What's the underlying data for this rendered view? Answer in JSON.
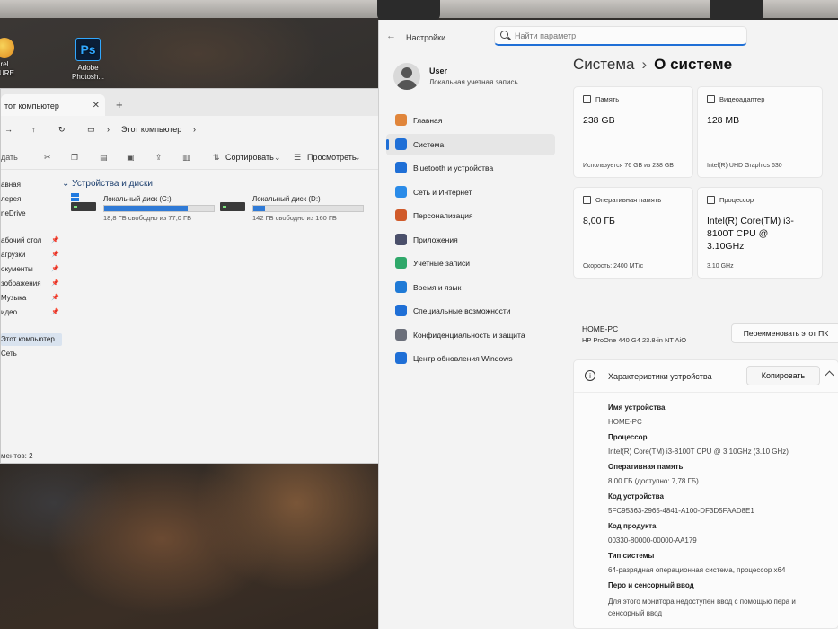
{
  "desktop": {
    "icons": [
      {
        "label": "rel\nTURE"
      },
      {
        "label": "Adobe\nPhotosh..."
      }
    ],
    "ps_glyph": "Ps"
  },
  "explorer": {
    "tab_title": "тот компьютер",
    "address": "Этот компьютер",
    "toolbar": {
      "create": "дать",
      "sort": "Сортировать",
      "view": "Просмотреть"
    },
    "group_title": "Устройства и диски",
    "nav": [
      {
        "label": "авная",
        "pinned": false
      },
      {
        "label": "лерея",
        "pinned": false
      },
      {
        "label": "neDrive",
        "pinned": false
      },
      {
        "label": "абочий стол",
        "pinned": true
      },
      {
        "label": "агрузки",
        "pinned": true
      },
      {
        "label": "окументы",
        "pinned": true
      },
      {
        "label": "зображения",
        "pinned": true
      },
      {
        "label": "Музыка",
        "pinned": true
      },
      {
        "label": "идео",
        "pinned": true
      },
      {
        "label": "Этот компьютер",
        "pinned": false,
        "selected": true
      },
      {
        "label": "Сеть",
        "pinned": false
      }
    ],
    "drives": [
      {
        "name": "Локальный диск (C:)",
        "free": "18,8 ГБ свободно из 77,0 ГБ",
        "used_fraction": 0.76
      },
      {
        "name": "Локальный диск (D:)",
        "free": "142 ГБ свободно из 160 ГБ",
        "used_fraction": 0.11
      }
    ],
    "status": "ментов: 2"
  },
  "settings": {
    "app_title": "Настройки",
    "search_placeholder": "Найти параметр",
    "user": {
      "name": "User",
      "subtitle": "Локальная учетная запись"
    },
    "nav": [
      {
        "label": "Главная",
        "icon": "home-icon",
        "color": "#e0853a"
      },
      {
        "label": "Система",
        "icon": "system-icon",
        "color": "#1f6fd6",
        "selected": true
      },
      {
        "label": "Bluetooth и устройства",
        "icon": "bluetooth-icon",
        "color": "#1f6fd6"
      },
      {
        "label": "Сеть и Интернет",
        "icon": "network-icon",
        "color": "#2a8be8"
      },
      {
        "label": "Персонализация",
        "icon": "brush-icon",
        "color": "#d05a2a"
      },
      {
        "label": "Приложения",
        "icon": "apps-icon",
        "color": "#4a4f6a"
      },
      {
        "label": "Учетные записи",
        "icon": "accounts-icon",
        "color": "#2fa86a"
      },
      {
        "label": "Время и язык",
        "icon": "time-language-icon",
        "color": "#1f7ad6"
      },
      {
        "label": "Специальные возможности",
        "icon": "accessibility-icon",
        "color": "#1f6fd6"
      },
      {
        "label": "Конфиденциальность и защита",
        "icon": "shield-icon",
        "color": "#6b6f7a"
      },
      {
        "label": "Центр обновления Windows",
        "icon": "update-icon",
        "color": "#1f6fd6"
      }
    ],
    "breadcrumb": {
      "parent": "Система",
      "separator": "›",
      "current": "О системе"
    },
    "cards": [
      {
        "title": "Память",
        "value": "238 GB",
        "sub": "Используется 76 GB из 238 GB"
      },
      {
        "title": "Видеоадаптер",
        "value": "128 MB",
        "sub": "Intel(R) UHD Graphics 630"
      },
      {
        "title": "Оперативная память",
        "value": "8,00 ГБ",
        "sub": "Скорость: 2400 МТ/с"
      },
      {
        "title": "Процессор",
        "value": "Intel(R) Core(TM) i3-8100T CPU @ 3.10GHz",
        "sub": "3.10 GHz"
      }
    ],
    "pc": {
      "name": "HOME-PC",
      "model": "HP ProOne 440 G4 23.8-in NT AiO",
      "rename_label": "Переименовать этот ПК"
    },
    "specs": {
      "title": "Характеристики устройства",
      "copy_label": "Копировать",
      "info_glyph": "i",
      "rows": [
        {
          "key": "Имя устройства",
          "value": "HOME-PC"
        },
        {
          "key": "Процессор",
          "value": "Intel(R) Core(TM) i3-8100T CPU @ 3.10GHz (3.10 GHz)"
        },
        {
          "key": "Оперативная память",
          "value": "8,00 ГБ (доступно: 7,78 ГБ)"
        },
        {
          "key": "Код устройства",
          "value": "5FC95363-2965-4841-A100-DF3D5FAAD8E1"
        },
        {
          "key": "Код продукта",
          "value": "00330-80000-00000-AA179"
        },
        {
          "key": "Тип системы",
          "value": "64-разрядная операционная система, процессор x64"
        },
        {
          "key": "Перо и сенсорный ввод",
          "value": "Для этого монитора недоступен ввод с помощью пера и сенсорный ввод"
        }
      ]
    }
  }
}
